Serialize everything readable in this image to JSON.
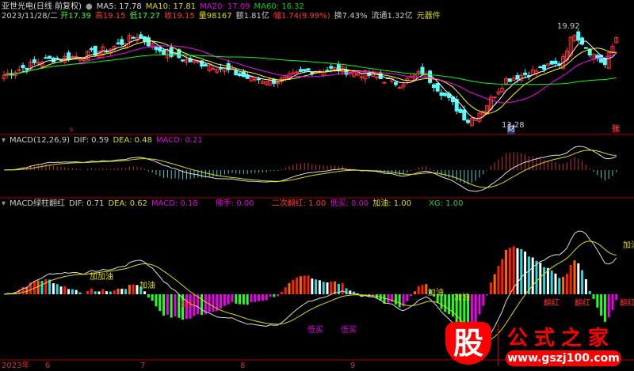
{
  "header": {
    "name": "亚世光电(日线 前复权)",
    "ma5": "MA5: 17.78",
    "ma10": "MA10: 17.81",
    "ma20": "MA20: 17.09",
    "ma60": "MA60: 16.32",
    "date": "2023/11/28/二",
    "open": "开17.39",
    "high": "高19.15",
    "low": "低17.27",
    "close": "收19.15",
    "vol": "量98167",
    "amount": "额1.81亿",
    "change": "幅1.74(9.99%)",
    "turnover": "换7.43%",
    "float": "流通1.32亿",
    "sector": "元器件"
  },
  "price": {
    "high_label": "19.92",
    "low_label": "13.28",
    "marker_left": "s",
    "marker_cai": "财",
    "marker_zhang": "张"
  },
  "macd": {
    "title": "MACD(12,26,9)",
    "dif": "DIF: 0.59",
    "dea": "DEA: 0.48",
    "macd": "MACD: 0.21"
  },
  "lower": {
    "title": "MACD绿柱翻红",
    "dif": "DIF: 0.71",
    "dea": "DEA: 0.62",
    "macd": "MACD: 0.18",
    "a": "佛手: 0.00",
    "b": "二次翻红: 1.00",
    "c": "低买: 0.00",
    "d": "加油: 1.00",
    "xg": "XG: 1.00",
    "sig_jiajiayou": "加加油",
    "sig_jiayou": "加油",
    "sig_fanhong": "翻红",
    "sig_dimai": "低买",
    "sig_jiayou_right": "加油"
  },
  "axis": {
    "year": "2023年",
    "m6": "6",
    "m7": "7",
    "m8": "8",
    "m9": "9"
  },
  "logo": {
    "char": "股",
    "text": "公式之家",
    "url": "www.gszj100.com"
  },
  "colors": {
    "up": "#ff3232",
    "down": "#54ffff",
    "ma5": "#ffffff",
    "ma10": "#ffff00",
    "ma20": "#ff00ff",
    "ma60": "#00ff00"
  },
  "chart_data": {
    "type": "candlestick",
    "price_keypoints": [
      [
        0,
        16.6
      ],
      [
        10,
        17.6
      ],
      [
        20,
        17.9
      ],
      [
        28,
        18.4
      ],
      [
        35,
        19.3
      ],
      [
        40,
        18.4
      ],
      [
        48,
        17.6
      ],
      [
        56,
        17.2
      ],
      [
        64,
        16.4
      ],
      [
        72,
        16.2
      ],
      [
        80,
        16.9
      ],
      [
        88,
        17.0
      ],
      [
        96,
        16.6
      ],
      [
        104,
        16.0
      ],
      [
        110,
        16.8
      ],
      [
        116,
        15.2
      ],
      [
        122,
        13.5
      ],
      [
        126,
        14.3
      ],
      [
        132,
        16.3
      ],
      [
        140,
        16.9
      ],
      [
        146,
        17.4
      ],
      [
        150,
        19.5
      ],
      [
        154,
        18.2
      ],
      [
        158,
        17.3
      ],
      [
        161,
        19.15
      ]
    ],
    "count": 162
  }
}
